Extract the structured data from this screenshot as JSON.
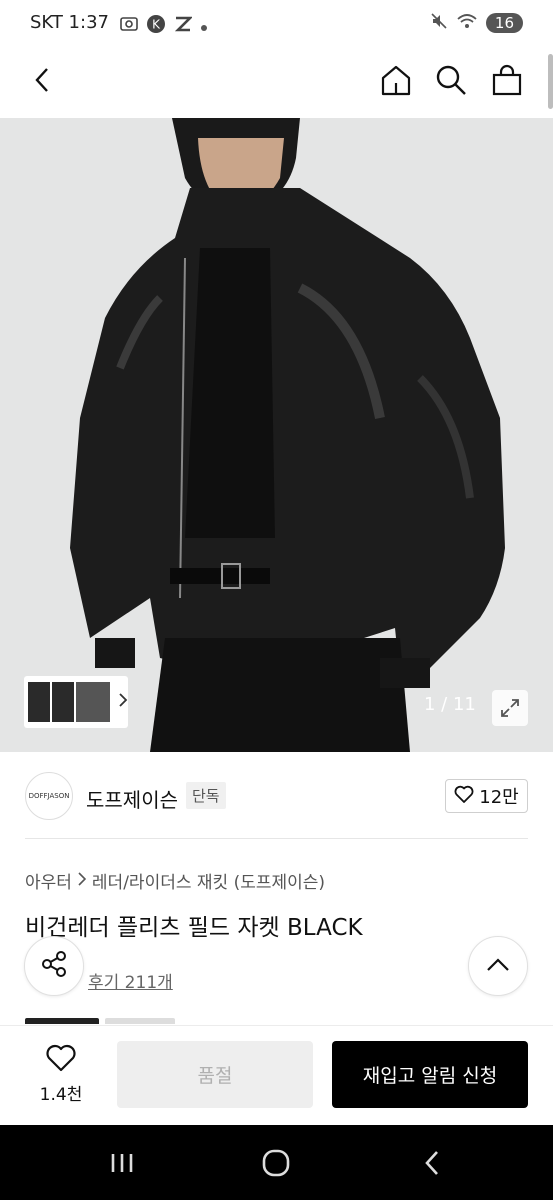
{
  "status_bar": {
    "carrier_time": "SKT 1:37",
    "battery": "16",
    "icons": [
      "screenshot-icon",
      "kakao-k-icon",
      "zigzag-z-icon",
      "dot-icon",
      "mute-icon",
      "wifi-icon"
    ]
  },
  "nav": {
    "icons": [
      "back-icon",
      "home-icon",
      "search-icon",
      "shopping-bag-icon"
    ]
  },
  "gallery": {
    "counter": "1 / 11",
    "colors": {
      "background": "#e3e4e4",
      "jacket": "#1b1b1b"
    }
  },
  "brand": {
    "logo_text": "DOFFJASON",
    "name": "도프제이슨",
    "badge": "단독",
    "likes": "12만"
  },
  "product": {
    "breadcrumb": [
      "아우터",
      "레더/라이더스 재킷 (도프제이슨)"
    ],
    "title": "비건레더 플리츠 필드 자켓 BLACK",
    "reviews": "후기 211개"
  },
  "bottom_bar": {
    "wish_count": "1.4천",
    "sold_out": "품절",
    "restock_alert": "재입고 알림 신청"
  },
  "system_nav": {
    "icons": [
      "recent-apps-icon",
      "home-circle-icon",
      "system-back-icon"
    ]
  }
}
